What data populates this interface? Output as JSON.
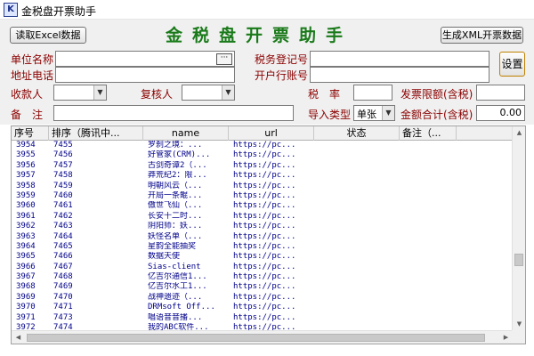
{
  "window": {
    "icon_letter": "K",
    "title": "金税盘开票助手"
  },
  "toolbar": {
    "read_excel_label": "读取Excel数据",
    "app_heading": "金税盘开票助手",
    "generate_xml_label": "生成XML开票数据",
    "settings_label": "设置",
    "browse_label": "···"
  },
  "form": {
    "company_name_label": "单位名称",
    "address_phone_label": "地址电话",
    "tax_id_label": "税务登记号",
    "bank_account_label": "开户行账号",
    "payee_label": "收款人",
    "reviewer_label": "复核人",
    "tax_rate_label": "税　率",
    "invoice_limit_label": "发票限额(含税)",
    "remark_label": "备　注",
    "import_type_label": "导入类型",
    "import_type_value": "单张",
    "total_label": "金额合计(含税)",
    "total_value": "0.00",
    "company_name_value": "",
    "address_phone_value": "",
    "tax_id_value": "",
    "bank_account_value": "",
    "tax_rate_value": "",
    "invoice_limit_value": "",
    "remark_value": ""
  },
  "table": {
    "columns": [
      "序号",
      "排序（腾讯中...",
      "name",
      "url",
      "状态",
      "备注（..."
    ],
    "rows": [
      [
        "3954",
        "7455",
        "罗刹之境：...",
        "https://pc..."
      ],
      [
        "3955",
        "7456",
        "好管家(CRM)...",
        "https://pc..."
      ],
      [
        "3956",
        "7457",
        "古剑奇谭2（...",
        "https://pc..."
      ],
      [
        "3957",
        "7458",
        "莽荒纪2：限...",
        "https://pc..."
      ],
      [
        "3958",
        "7459",
        "明朝风云（...",
        "https://pc..."
      ],
      [
        "3959",
        "7460",
        "开局一条鲲...",
        "https://pc..."
      ],
      [
        "3960",
        "7461",
        "傲世飞仙（...",
        "https://pc..."
      ],
      [
        "3961",
        "7462",
        "长安十二时...",
        "https://pc..."
      ],
      [
        "3962",
        "7463",
        "阴阳师：妖...",
        "https://pc..."
      ],
      [
        "3963",
        "7464",
        "妖怪名单（...",
        "https://pc..."
      ],
      [
        "3964",
        "7465",
        "星韵全能抽奖",
        "https://pc..."
      ],
      [
        "3965",
        "7466",
        "数据天使",
        "https://pc..."
      ],
      [
        "3966",
        "7467",
        "Sias-client",
        "https://pc..."
      ],
      [
        "3967",
        "7468",
        "亿吉尔通信1...",
        "https://pc..."
      ],
      [
        "3968",
        "7469",
        "亿吉尔水工1...",
        "https://pc..."
      ],
      [
        "3969",
        "7470",
        "战神遗迹（...",
        "https://pc..."
      ],
      [
        "3970",
        "7471",
        "DRMsoft Off...",
        "https://pc..."
      ],
      [
        "3971",
        "7473",
        "唱语音音播...",
        "https://pc..."
      ],
      [
        "3972",
        "7474",
        "我的ABC软件...",
        "https://pc..."
      ]
    ]
  },
  "colors": {
    "heading_green": "#1a7a1a",
    "label_red": "#8b0000",
    "cell_blue": "#00008b"
  },
  "icons": {
    "app": "k-app-icon",
    "combo": "chevron-down-icon"
  }
}
